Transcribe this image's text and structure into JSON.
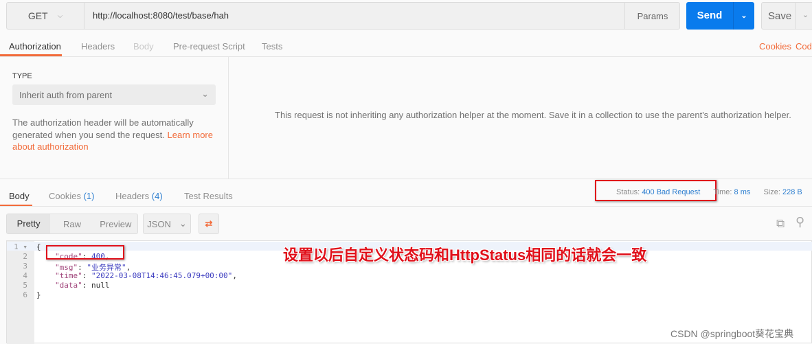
{
  "request": {
    "method": "GET",
    "url": "http://localhost:8080/test/base/hah",
    "params_label": "Params",
    "send_label": "Send",
    "save_label": "Save"
  },
  "req_tabs": [
    "Authorization",
    "Headers",
    "Body",
    "Pre-request Script",
    "Tests"
  ],
  "req_links": {
    "cookies": "Cookies",
    "code": "Code"
  },
  "auth": {
    "type_label": "TYPE",
    "type_value": "Inherit auth from parent",
    "help_text": "The authorization header will be automatically generated when you send the request.",
    "learn_more": "Learn more about authorization",
    "message": "This request is not inheriting any authorization helper at the moment. Save it in a collection to use the parent's authorization helper."
  },
  "resp_tabs": {
    "body": "Body",
    "cookies": "Cookies",
    "cookies_count": "(1)",
    "headers": "Headers",
    "headers_count": "(4)",
    "tests": "Test Results"
  },
  "status": {
    "status_label": "Status:",
    "status_value": "400 Bad Request",
    "time_label": "Time:",
    "time_value": "8 ms",
    "size_label": "Size:",
    "size_value": "228 B"
  },
  "view": {
    "pretty": "Pretty",
    "raw": "Raw",
    "preview": "Preview",
    "format": "JSON"
  },
  "body_lines": {
    "l1": "{",
    "l2k": "\"code\"",
    "l2v": "400",
    "l3k": "\"msg\"",
    "l3v": "\"业务异常\"",
    "l4k": "\"time\"",
    "l4v": "\"2022-03-08T14:46:45.079+00:00\"",
    "l5k": "\"data\"",
    "l5v": "null",
    "l6": "}"
  },
  "annotation": "设置以后自定义状态码和HttpStatus相同的话就会一致",
  "watermark": "CSDN @springboot葵花宝典",
  "colors": {
    "accent": "#f26b3a",
    "send": "#097bed",
    "annotation": "#e0101a"
  }
}
